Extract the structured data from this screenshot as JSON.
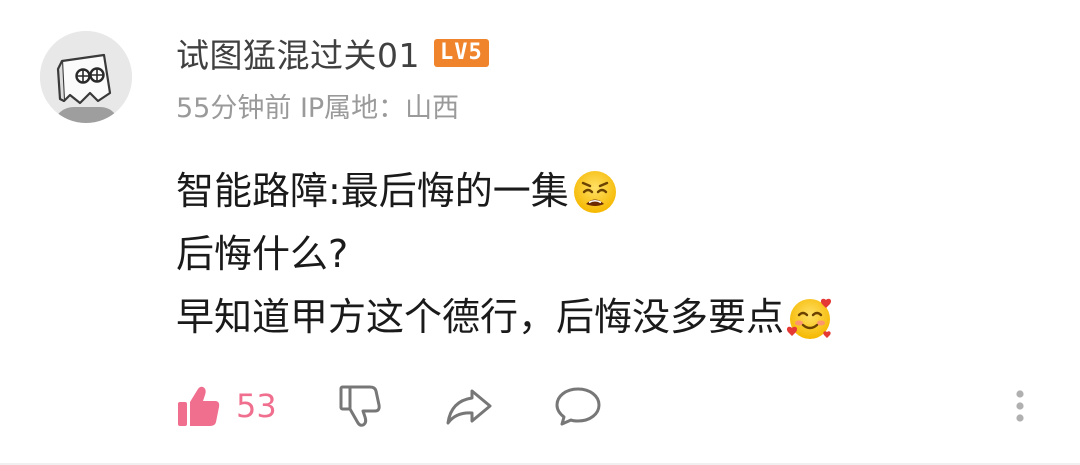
{
  "comment": {
    "username": "试图猛混过关01",
    "level_badge": "LV5",
    "meta": "55分钟前 IP属地：山西",
    "lines": [
      "智能路障:最后悔的一集",
      "后悔什么?",
      "早知道甲方这个德行，后悔没多要点"
    ],
    "emojis": [
      "weary-face-emoji",
      "smiling-face-with-hearts-emoji"
    ],
    "like_count": "53"
  },
  "colors": {
    "level_badge_bg": "#f0842c",
    "like_accent": "#f06e8e",
    "meta_text": "#9a9a9a",
    "icon_gray": "#777777"
  }
}
